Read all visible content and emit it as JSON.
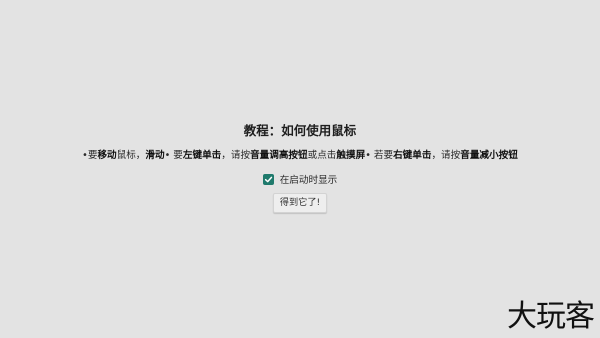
{
  "tutorial": {
    "title": "教程：如何使用鼠标",
    "instructions": [
      {
        "text": "•要",
        "bold": false
      },
      {
        "text": "移动",
        "bold": true
      },
      {
        "text": "鼠标，",
        "bold": false
      },
      {
        "text": "滑动",
        "bold": true
      },
      {
        "text": "• 要",
        "bold": false
      },
      {
        "text": "左键单击",
        "bold": true
      },
      {
        "text": "，请按",
        "bold": false
      },
      {
        "text": "音量调高按钮",
        "bold": true
      },
      {
        "text": "或点击",
        "bold": false
      },
      {
        "text": "触摸屏",
        "bold": true
      },
      {
        "text": "• 若要",
        "bold": false
      },
      {
        "text": "右键单击",
        "bold": true
      },
      {
        "text": "，请按",
        "bold": false
      },
      {
        "text": "音量减小按钮",
        "bold": true
      }
    ],
    "show_on_startup": {
      "label": "在启动时显示",
      "checked": true
    },
    "got_it_label": "得到它了!"
  },
  "watermark": "大玩客",
  "colors": {
    "background": "#e3e3e3",
    "checkbox_accent": "#1f7a6c"
  },
  "icons": {
    "checkbox": "checkmark-icon"
  }
}
